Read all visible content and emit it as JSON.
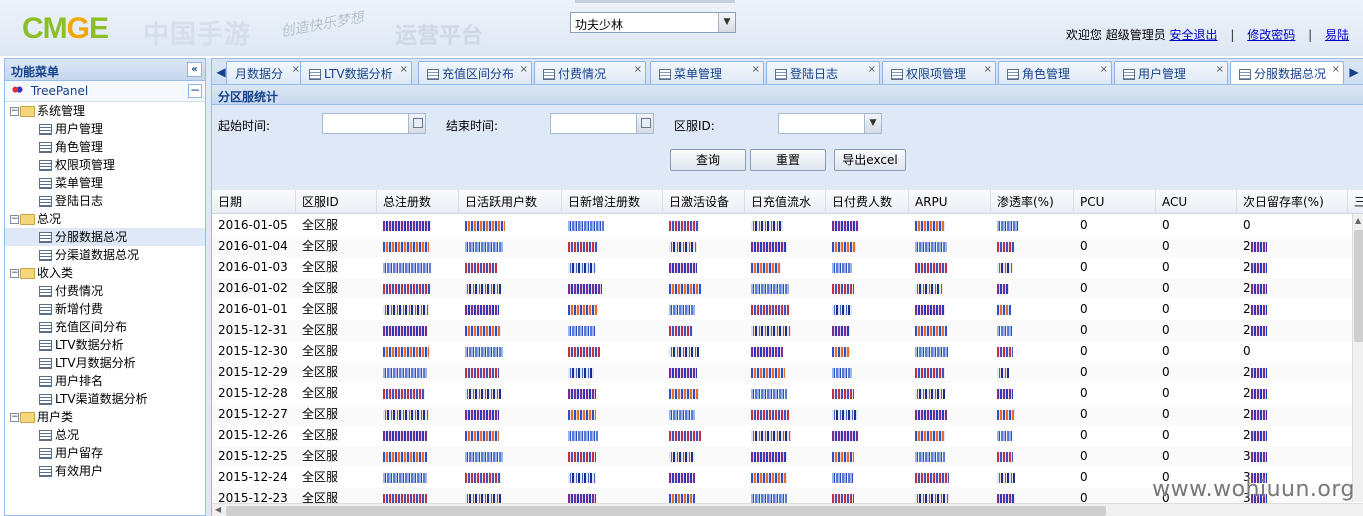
{
  "header": {
    "logo_text": "CMGE",
    "logo_cn": "中国手游",
    "slogan": "创造快乐梦想",
    "platform_title": "运营平台",
    "game_select": {
      "value": "功夫少林"
    },
    "user": {
      "welcome": "欢迎您",
      "username": "超级管理员",
      "logout": "安全退出",
      "change_password": "修改密码",
      "exit": "易陆",
      "separator": "|"
    }
  },
  "left_panel": {
    "title": "功能菜单",
    "collapse": "«",
    "tree_label": "TreePanel",
    "tree_collapse": "−",
    "groups": [
      {
        "label": "系统管理",
        "items": [
          "用户管理",
          "角色管理",
          "权限项管理",
          "菜单管理",
          "登陆日志"
        ]
      },
      {
        "label": "总况",
        "items": [
          "分服数据总况",
          "分渠道数据总况"
        ]
      },
      {
        "label": "收入类",
        "items": [
          "付费情况",
          "新增付费",
          "充值区间分布",
          "LTV数据分析",
          "LTV月数据分析",
          "用户排名",
          "LTV渠道数据分析"
        ]
      },
      {
        "label": "用户类",
        "items": [
          "总况",
          "用户留存",
          "有效用户"
        ]
      }
    ],
    "selected_item": "分服数据总况"
  },
  "tabs": [
    {
      "label": "月数据分"
    },
    {
      "label": "LTV数据分析"
    },
    {
      "label": "充值区间分布"
    },
    {
      "label": "付费情况"
    },
    {
      "label": "菜单管理"
    },
    {
      "label": "登陆日志"
    },
    {
      "label": "权限项管理"
    },
    {
      "label": "角色管理"
    },
    {
      "label": "用户管理"
    },
    {
      "label": "分服数据总况"
    }
  ],
  "tab_scroll_left": "◀",
  "tab_scroll_right": "▶",
  "tab_close": "×",
  "panel": {
    "title": "分区服统计",
    "form": {
      "start_label": "起始时间:",
      "end_label": "结束时间:",
      "server_label": "区服ID:",
      "start_value": "",
      "end_value": "",
      "server_value": "",
      "query_button": "查询",
      "reset_button": "重置",
      "export_button": "导出excel"
    }
  },
  "grid": {
    "columns": [
      "日期",
      "区服ID",
      "总注册数",
      "日活跃用户数",
      "日新增注册数",
      "日激活设备",
      "日充值流水",
      "日付费人数",
      "ARPU",
      "渗透率(%)",
      "PCU",
      "ACU",
      "次日留存率(%)",
      "三"
    ],
    "rows": [
      {
        "date": "2016-01-05",
        "server": "全区服",
        "pcu": "0",
        "acu": "0",
        "retention": "0"
      },
      {
        "date": "2016-01-04",
        "server": "全区服",
        "pcu": "0",
        "acu": "0",
        "retention": "2"
      },
      {
        "date": "2016-01-03",
        "server": "全区服",
        "pcu": "0",
        "acu": "0",
        "retention": "2"
      },
      {
        "date": "2016-01-02",
        "server": "全区服",
        "pcu": "0",
        "acu": "0",
        "retention": "2"
      },
      {
        "date": "2016-01-01",
        "server": "全区服",
        "pcu": "0",
        "acu": "0",
        "retention": "2"
      },
      {
        "date": "2015-12-31",
        "server": "全区服",
        "pcu": "0",
        "acu": "0",
        "retention": "2"
      },
      {
        "date": "2015-12-30",
        "server": "全区服",
        "pcu": "0",
        "acu": "0",
        "retention": "0"
      },
      {
        "date": "2015-12-29",
        "server": "全区服",
        "pcu": "0",
        "acu": "0",
        "retention": "2"
      },
      {
        "date": "2015-12-28",
        "server": "全区服",
        "pcu": "0",
        "acu": "0",
        "retention": "2"
      },
      {
        "date": "2015-12-27",
        "server": "全区服",
        "pcu": "0",
        "acu": "0",
        "retention": "2"
      },
      {
        "date": "2015-12-26",
        "server": "全区服",
        "pcu": "0",
        "acu": "0",
        "retention": "2"
      },
      {
        "date": "2015-12-25",
        "server": "全区服",
        "pcu": "0",
        "acu": "0",
        "retention": "3"
      },
      {
        "date": "2015-12-24",
        "server": "全区服",
        "pcu": "0",
        "acu": "0",
        "retention": "3"
      },
      {
        "date": "2015-12-23",
        "server": "全区服",
        "pcu": "0",
        "acu": "0",
        "retention": "3"
      }
    ]
  },
  "watermark": "www.wohiuun.org"
}
